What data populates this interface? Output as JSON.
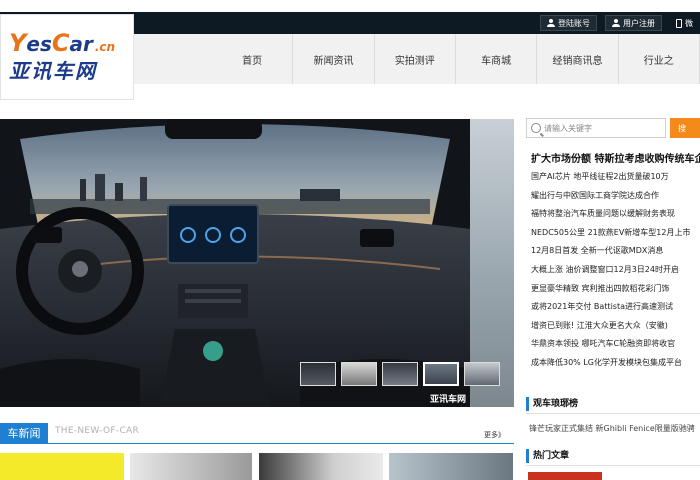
{
  "topbar": {
    "login": "登陆账号",
    "register": "用户注册",
    "weibo": "微"
  },
  "logo": {
    "y": "Y",
    "es": "es",
    "c": "C",
    "ar": "ar",
    "cn": ".cn",
    "name": "亚讯车网"
  },
  "nav": {
    "items": [
      "首页",
      "新闻资讯",
      "实拍测评",
      "车商城",
      "经销商讯息",
      "行业之"
    ]
  },
  "hero": {
    "caption": "亚讯车网"
  },
  "search": {
    "placeholder": "请输入关键字",
    "button": "搜"
  },
  "headline": "扩大市场份额 特斯拉考虑收购传统车企",
  "news": [
    "国产AI芯片 地平线征程2出货量破10万",
    "耀出行与中欧国际工商学院达成合作",
    "福特将整治汽车质量问题以缓解财务表现",
    "NEDC505公里 21款燕EV新增车型12月上市",
    "12月8日首发 全新一代讴歌MDX消息",
    "大概上涨 油价调整窗口12月3日24时开启",
    "更显豪华精致 宾利推出四款稻花彩门饰",
    "或将2021年交付 Battista进行高速测试",
    "增资已到账! 江淮大众更名大众（安徽)",
    "华鼎资本领投 哪吒汽车C轮融资即将收官",
    "成本降低30% LG化学开发模块包集成平台"
  ],
  "sections": {
    "ranking": "观车琅琊榜",
    "ranking_text": "锋芒玩家正式集结 新Ghibli Fenice限量版驰骋",
    "hot": "热门文章"
  },
  "car_news": {
    "tag": "车新闻",
    "subtitle": "THE-NEW-OF-CAR",
    "more": "更多》"
  },
  "colors": {
    "accent_blue": "#1f7fd0",
    "accent_orange": "#f38a1a",
    "brand_blue": "#1d3b8b",
    "brand_orange": "#e8731a"
  }
}
